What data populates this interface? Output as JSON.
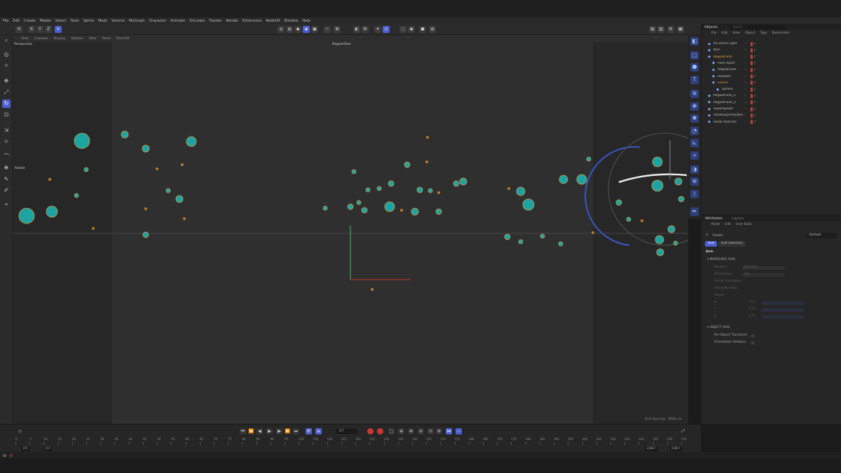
{
  "menu": [
    "File",
    "Edit",
    "Create",
    "Modes",
    "Select",
    "Tools",
    "Spline",
    "Mesh",
    "Volume",
    "MoGraph",
    "Character",
    "Animate",
    "Simulate",
    "Tracker",
    "Render",
    "Extensions",
    "Redshift",
    "Window",
    "Help"
  ],
  "viewport": {
    "menu": [
      "View",
      "Cameras",
      "Display",
      "Options",
      "Filter",
      "Panel",
      "Redshift"
    ],
    "camera": "Perspective",
    "object_name": "RegularSize",
    "tool_label": "Rotate",
    "grid_spacing": "Grid Spacing : 5000 cm"
  },
  "objects": {
    "tab": "Objects",
    "search_placeholder": "Search",
    "menu": [
      "File",
      "Edit",
      "View",
      "Object",
      "Tags",
      "Bookmarks"
    ],
    "items": [
      {
        "name": "RS Dome Light",
        "indent": 0,
        "color": "normal"
      },
      {
        "name": "Null",
        "indent": 0,
        "color": "normal"
      },
      {
        "name": "RegularSize",
        "indent": 0,
        "color": "orange"
      },
      {
        "name": "Push Apart",
        "indent": 1,
        "color": "normal"
      },
      {
        "name": "RegularSize",
        "indent": 1,
        "color": "normal"
      },
      {
        "name": "Random",
        "indent": 1,
        "color": "normal"
      },
      {
        "name": "Cloner",
        "indent": 1,
        "color": "orange"
      },
      {
        "name": "Sphere",
        "indent": 2,
        "color": "normal"
      },
      {
        "name": "RegularSize_2",
        "indent": 0,
        "color": "normal"
      },
      {
        "name": "RegularSize_3",
        "indent": 0,
        "color": "normal"
      },
      {
        "name": "SuperSplash",
        "indent": 0,
        "color": "normal"
      },
      {
        "name": "SmallSuperVolatile",
        "indent": 0,
        "color": "normal"
      },
      {
        "name": "Small Particles",
        "indent": 0,
        "color": "normal"
      }
    ]
  },
  "attributes": {
    "tab": "Attributes",
    "layers_tab": "Layers",
    "menu": [
      "Mode",
      "Edit",
      "User Data"
    ],
    "title": "Rotate",
    "preset": "Default",
    "sub_tabs": [
      "Axis",
      "Soft Selection"
    ],
    "section_heading": "Axis",
    "modeling_axis": "MODELING AXIS",
    "modeling_rows": [
      "Position",
      "Orientation",
      "Along Orientation",
      "Along Normals"
    ],
    "modeling_values": [
      "Selected",
      "Axis"
    ],
    "object_axis": "OBJECT AXIS",
    "object_options": [
      "Per-Object Transform",
      "Orientation Rotation"
    ],
    "xyz": [
      "X",
      "Y",
      "Z"
    ],
    "percent": "0 %"
  },
  "timeline": {
    "current_frame": "0 F",
    "start_field": "0 F",
    "start_field_2": "0 F",
    "end_field": "238 F",
    "end_field_2": "238 F",
    "ruler_ticks": [
      "0",
      "5",
      "10",
      "15",
      "20",
      "25",
      "30",
      "35",
      "40",
      "45",
      "50",
      "55",
      "60",
      "65",
      "70",
      "75",
      "80",
      "85",
      "90",
      "95",
      "100",
      "105",
      "110",
      "115",
      "120",
      "125",
      "130",
      "135",
      "140",
      "145",
      "150",
      "155",
      "160",
      "165",
      "170",
      "175",
      "180",
      "185",
      "190",
      "195",
      "200",
      "205",
      "210",
      "215",
      "220",
      "225",
      "230",
      "235"
    ]
  },
  "colors": {
    "accent": "#4d5fd0",
    "sphere": "#1ea3a3",
    "record": "#c93636",
    "check": "#5bd35b",
    "orange_label": "#e3a93a"
  }
}
